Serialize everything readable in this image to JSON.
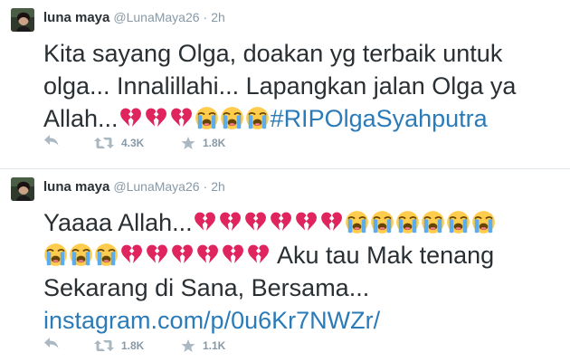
{
  "tweets": [
    {
      "fullname": "luna maya",
      "username": "@LunaMaya26",
      "separator": "·",
      "time": "2h",
      "text_lines": [
        "Kita sayang Olga, doakan yg terbaik untuk",
        "olga... Innalillahi... Lapangkan jalan Olga ya",
        "Allah..."
      ],
      "line3_emojis": [
        "broken-heart",
        "broken-heart",
        "broken-heart",
        "loudly-crying-face",
        "loudly-crying-face",
        "loudly-crying-face"
      ],
      "hashtag": "#RIPOlgaSyahputra",
      "retweet_count": "4.3K",
      "favorite_count": "1.8K"
    },
    {
      "fullname": "luna maya",
      "username": "@LunaMaya26",
      "separator": "·",
      "time": "2h",
      "line1_text": "Yaaaa Allah...",
      "line1_emojis": [
        "broken-heart",
        "broken-heart",
        "broken-heart",
        "broken-heart",
        "broken-heart",
        "broken-heart",
        "loudly-crying-face",
        "loudly-crying-face",
        "loudly-crying-face",
        "loudly-crying-face",
        "loudly-crying-face",
        "loudly-crying-face"
      ],
      "line2_emojis": [
        "loudly-crying-face",
        "loudly-crying-face",
        "loudly-crying-face",
        "broken-heart",
        "broken-heart",
        "broken-heart",
        "broken-heart",
        "broken-heart",
        "broken-heart"
      ],
      "line2_text": " Aku tau Mak tenang",
      "line3_text": "Sekarang di Sana, Bersama...",
      "link": "instagram.com/p/0u6Kr7NWZr/",
      "retweet_count": "1.8K",
      "favorite_count": "1.1K"
    }
  ],
  "colors": {
    "text": "#292f33",
    "meta": "#8899a6",
    "link": "#2b7bb9",
    "divider": "#e1e8ed",
    "broken_heart": "#e0245e",
    "crying_face": "#ffcc4d",
    "tears": "#5dadec"
  },
  "icons": {
    "reply": "reply-icon",
    "retweet": "retweet-icon",
    "favorite": "star-icon"
  }
}
